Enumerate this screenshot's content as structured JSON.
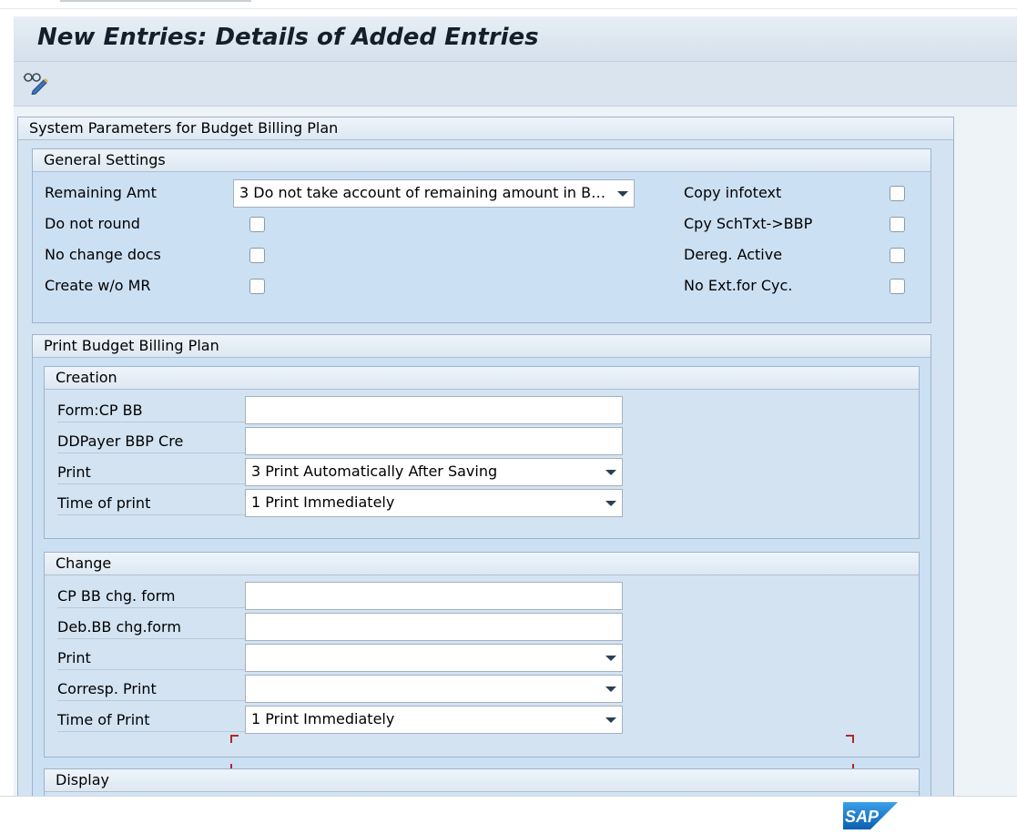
{
  "window": {
    "title": "New Entries: Details of Added Entries"
  },
  "toolbar": {
    "display_change_icon": "glasses-pencil-icon"
  },
  "system_group": {
    "title": "System Parameters for Budget Billing Plan"
  },
  "general": {
    "title": "General Settings",
    "remaining_amt": {
      "label": "Remaining Amt",
      "value": "3 Do not take account of remaining amount in BB..."
    },
    "do_not_round": {
      "label": "Do not round",
      "checked": false
    },
    "no_change_docs": {
      "label": "No change docs",
      "checked": false
    },
    "create_wo_mr": {
      "label": "Create w/o MR",
      "checked": false
    },
    "copy_infotext": {
      "label": "Copy infotext",
      "checked": false
    },
    "cpy_schtxt": {
      "label": "Cpy SchTxt->BBP",
      "checked": false
    },
    "dereg_active": {
      "label": "Dereg. Active",
      "checked": false
    },
    "no_ext_cyc": {
      "label": "No Ext.for Cyc.",
      "checked": false
    }
  },
  "print_group": {
    "title": "Print Budget Billing Plan"
  },
  "creation": {
    "title": "Creation",
    "form_cp_bb": {
      "label": "Form:CP BB",
      "value": ""
    },
    "ddpayer": {
      "label": "DDPayer BBP Cre",
      "value": ""
    },
    "print": {
      "label": "Print",
      "value": "3 Print Automatically After Saving"
    },
    "time_of_print": {
      "label": "Time of print",
      "value": "1 Print Immediately"
    }
  },
  "change": {
    "title": "Change",
    "cp_bb_chg_form": {
      "label": "CP BB chg. form",
      "value": ""
    },
    "deb_bb_chg_form": {
      "label": "Deb.BB chg.form",
      "value": ""
    },
    "print": {
      "label": "Print",
      "value": ""
    },
    "corresp_print": {
      "label": "Corresp. Print",
      "value": ""
    },
    "time_of_print": {
      "label": "Time of Print",
      "value": "1 Print Immediately"
    }
  },
  "display": {
    "title": "Display"
  },
  "colors": {
    "accent": "#b4262a",
    "panel": "#d3e3f2",
    "border": "#9db3ca"
  },
  "branding": {
    "logo": "SAP"
  }
}
